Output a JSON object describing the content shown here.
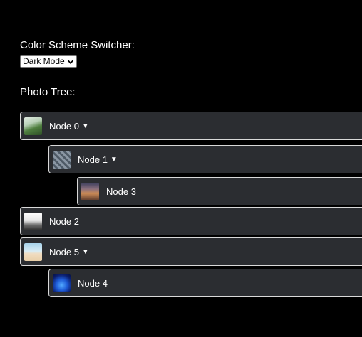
{
  "color_scheme": {
    "label": "Color Scheme Switcher:",
    "selected": "Dark Mode"
  },
  "tree": {
    "label": "Photo Tree:",
    "nodes": [
      {
        "label": "Node 0",
        "caret": "▼",
        "level": 0,
        "thumbnail": "photo-thumbnail-green"
      },
      {
        "label": "Node 1",
        "caret": "▼",
        "level": 1,
        "thumbnail": "photo-thumbnail-grey-texture"
      },
      {
        "label": "Node 3",
        "caret": "",
        "level": 2,
        "thumbnail": "photo-thumbnail-sunset"
      },
      {
        "label": "Node 2",
        "caret": "",
        "level": 0,
        "thumbnail": "photo-thumbnail-mono"
      },
      {
        "label": "Node 5",
        "caret": "▼",
        "level": 0,
        "thumbnail": "photo-thumbnail-beach"
      },
      {
        "label": "Node 4",
        "caret": "",
        "level": 1,
        "thumbnail": "photo-thumbnail-blue-glow"
      }
    ]
  },
  "colors": {
    "background": "#000000",
    "node_background": "#2b2d31",
    "node_border": "#d9d9d9",
    "text": "#ffffff"
  }
}
